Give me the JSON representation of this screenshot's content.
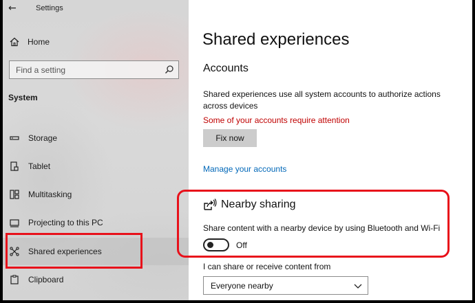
{
  "window": {
    "back_glyph": "←",
    "title": "Settings"
  },
  "sidebar": {
    "home_label": "Home",
    "search_placeholder": "Find a setting",
    "section_label": "System",
    "items": [
      {
        "label": "Storage",
        "icon": "storage-icon"
      },
      {
        "label": "Tablet",
        "icon": "tablet-icon"
      },
      {
        "label": "Multitasking",
        "icon": "multitasking-icon"
      },
      {
        "label": "Projecting to this PC",
        "icon": "projecting-icon"
      },
      {
        "label": "Shared experiences",
        "icon": "shared-experiences-icon",
        "selected": true
      },
      {
        "label": "Clipboard",
        "icon": "clipboard-icon"
      }
    ]
  },
  "main": {
    "title": "Shared experiences",
    "accounts": {
      "heading": "Accounts",
      "description": "Shared experiences use all system accounts to authorize actions across devices",
      "warning": "Some of your accounts require attention",
      "fix_button": "Fix now",
      "manage_link": "Manage your accounts"
    },
    "nearby": {
      "heading": "Nearby sharing",
      "description": "Share content with a nearby device by using Bluetooth and Wi-Fi",
      "toggle_state": "Off",
      "share_label": "I can share or receive content from",
      "dropdown_value": "Everyone nearby"
    }
  },
  "colors": {
    "highlight": "#e8101a",
    "link": "#0067b8",
    "warning": "#c00000"
  }
}
